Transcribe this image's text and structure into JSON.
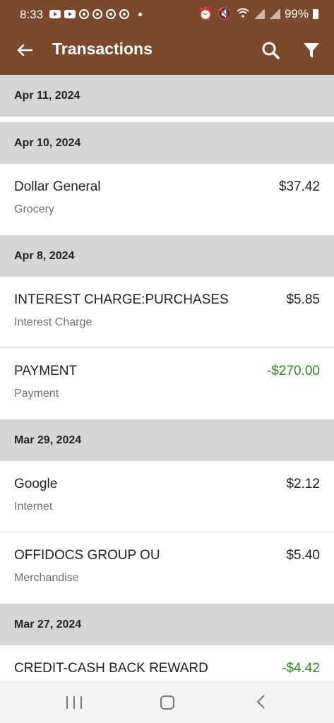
{
  "status_bar": {
    "time": "8:33",
    "battery": "99%"
  },
  "app_bar": {
    "title": "Transactions",
    "icons": [
      "back-arrow-icon",
      "search-icon",
      "filter-icon"
    ],
    "color": "#7b4a2d"
  },
  "transactions": {
    "groups": [
      {
        "date": "Apr 11, 2024",
        "items": []
      },
      {
        "date": "Apr 10, 2024",
        "items": [
          {
            "merchant": "Dollar General",
            "category": "Grocery",
            "amount": "$37.42"
          }
        ]
      },
      {
        "date": "Apr 8, 2024",
        "items": [
          {
            "merchant": "INTEREST CHARGE:PURCHASES",
            "category": "Interest Charge",
            "amount": "$5.85"
          },
          {
            "merchant": "PAYMENT",
            "category": "Payment",
            "amount": "-$270.00"
          }
        ]
      },
      {
        "date": "Mar 29, 2024",
        "items": [
          {
            "merchant": "Google",
            "category": "Internet",
            "amount": "$2.12"
          },
          {
            "merchant": "OFFIDOCS GROUP OU",
            "category": "Merchandise",
            "amount": "$5.40"
          }
        ]
      },
      {
        "date": "Mar 27, 2024",
        "items": [
          {
            "merchant": "CREDIT-CASH BACK REWARD",
            "category": "",
            "amount": "-$4.42"
          }
        ]
      }
    ],
    "credit_color": "#2a8a1f"
  },
  "nav_bar": {
    "icons": [
      "recents-icon",
      "home-icon",
      "back-icon"
    ]
  }
}
